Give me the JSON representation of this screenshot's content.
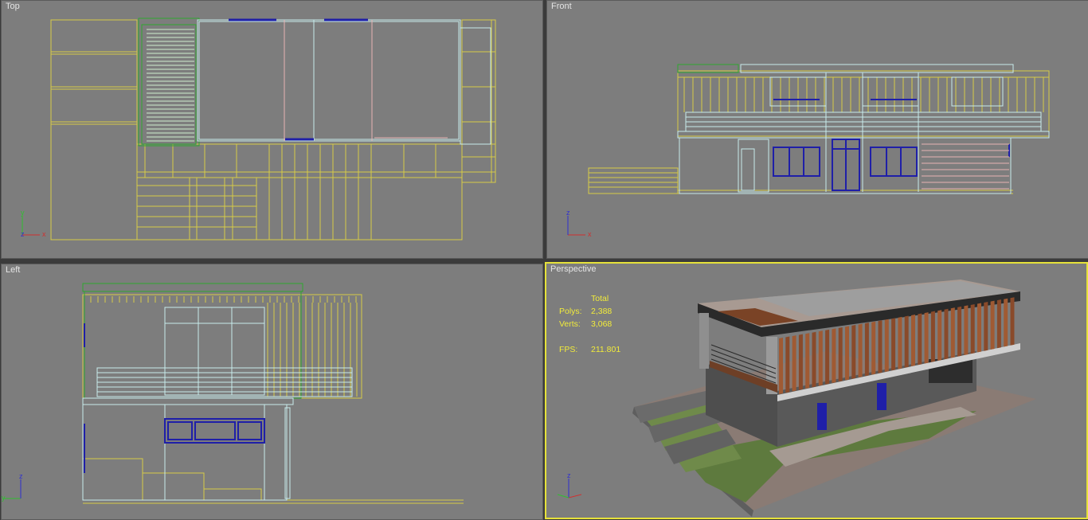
{
  "viewports": {
    "top": {
      "label": "Top",
      "axis": {
        "h": "x",
        "v": "y"
      }
    },
    "front": {
      "label": "Front",
      "axis": {
        "h": "x",
        "v": "z"
      }
    },
    "left": {
      "label": "Left",
      "axis": {
        "h": "y",
        "v": "z"
      }
    },
    "perspective": {
      "label": "Perspective",
      "axis": {
        "h": "x",
        "v": "z"
      },
      "stats": {
        "header": "Total",
        "polys_label": "Polys:",
        "polys_value": "2,388",
        "verts_label": "Verts:",
        "verts_value": "3,068",
        "fps_label": "FPS:",
        "fps_value": "211.801"
      }
    }
  },
  "colors": {
    "viewport_bg": "#7d7d7d",
    "active_border": "#e6e23a",
    "wire_yellow": "#d6cc46",
    "wire_green": "#2fa82f",
    "wire_cyan": "#c8ecec",
    "wire_blue": "#1f1fa8",
    "wire_pink": "#e8b4b4",
    "stats_text": "#f2ec3a"
  }
}
